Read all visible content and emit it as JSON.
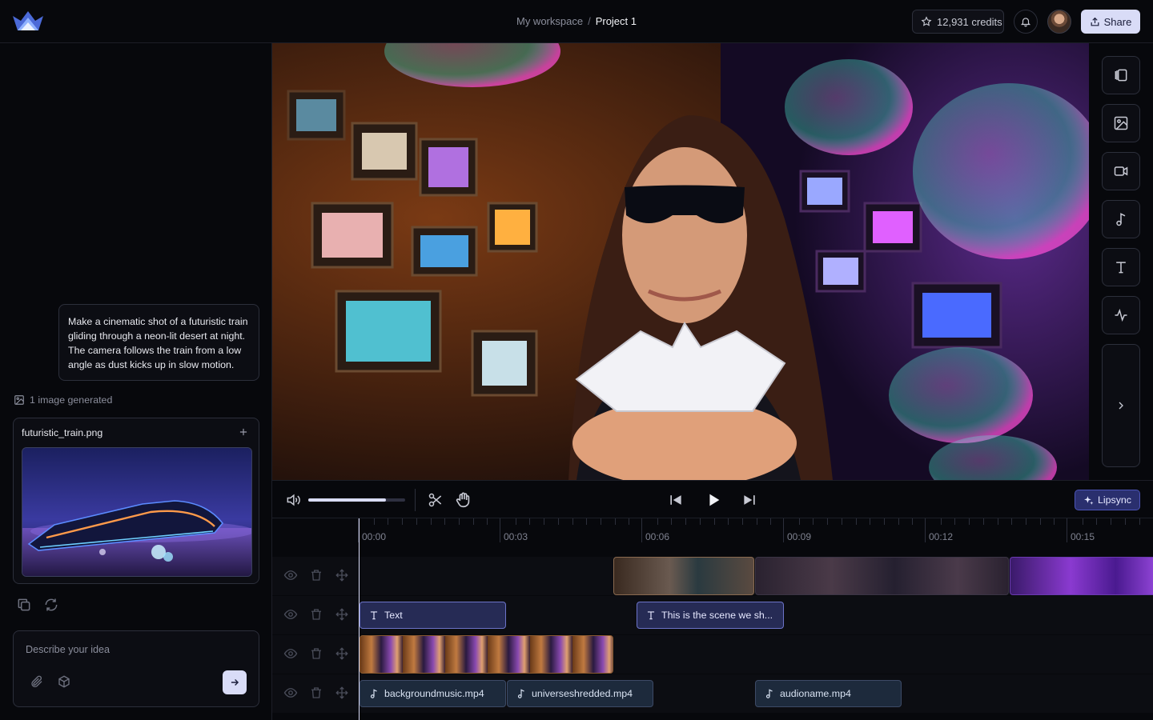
{
  "header": {
    "breadcrumb_workspace": "My workspace",
    "breadcrumb_separator": "/",
    "breadcrumb_project": "Project 1",
    "credits": "12,931 credits",
    "share_label": "Share"
  },
  "chat": {
    "prompt": "Make a cinematic shot of a futuristic train gliding through a neon-lit desert at night. The camera follows the train from a low angle as dust kicks up in slow motion.",
    "generated_label": "1 image generated",
    "image_filename": "futuristic_train.png",
    "input_placeholder": "Describe your idea"
  },
  "controls": {
    "volume": 0.8,
    "lipsync_label": "Lipsync"
  },
  "timeline": {
    "time_labels": [
      "00:00",
      "00:03",
      "00:06",
      "00:09",
      "00:12",
      "00:15"
    ],
    "text_clips": [
      "Text",
      "This is the scene we sh..."
    ],
    "audio_clips": [
      "backgroundmusic.mp4",
      "universeshredded.mp4",
      "audioname.mp4"
    ]
  },
  "colors": {
    "accent": "#d9dcf7",
    "background": "#07080c",
    "panel_border": "#2c2f3b",
    "text_clip": "#262b55",
    "audio_clip": "#1d2a3c"
  },
  "icons": [
    "logo-crown-icon",
    "star-icon",
    "bell-icon",
    "share-icon",
    "image-icon",
    "plus-icon",
    "copy-icon",
    "refresh-icon",
    "paperclip-icon",
    "cube-icon",
    "arrow-right-icon",
    "sidebar-toggle-icon",
    "video-icon",
    "music-note-icon",
    "text-icon",
    "waveform-icon",
    "chevron-right-icon",
    "volume-icon",
    "scissors-icon",
    "hand-icon",
    "skip-back-icon",
    "play-icon",
    "skip-forward-icon",
    "sparkle-icon",
    "eye-icon",
    "trash-icon",
    "move-icon"
  ]
}
